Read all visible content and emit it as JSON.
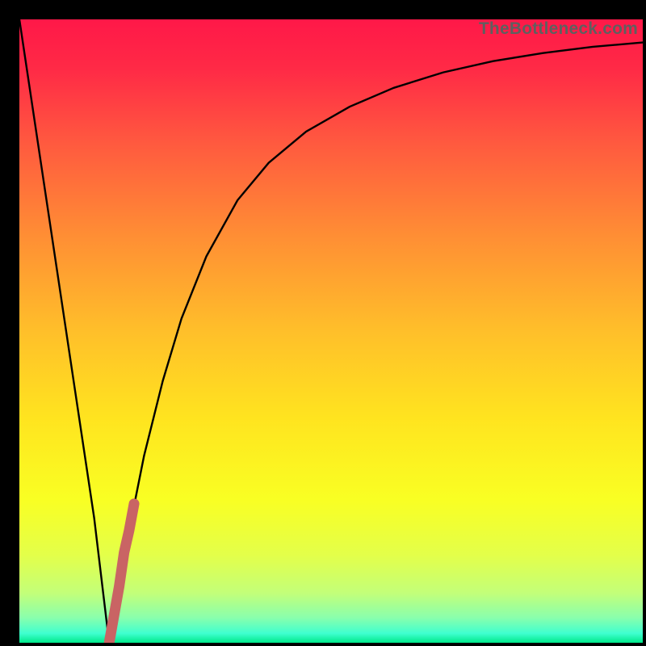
{
  "watermark": {
    "text": "TheBottleneck.com"
  },
  "chart_data": {
    "type": "line",
    "title": "",
    "xlabel": "",
    "ylabel": "",
    "xlim": [
      0,
      100
    ],
    "ylim": [
      0,
      100
    ],
    "grid": false,
    "legend": false,
    "series": [
      {
        "name": "bottleneck-curve",
        "x": [
          0,
          3,
          6,
          9,
          12,
          14.4,
          16,
          18,
          20,
          23,
          26,
          30,
          35,
          40,
          46,
          53,
          60,
          68,
          76,
          84,
          92,
          100
        ],
        "values": [
          100,
          80,
          60,
          40,
          20,
          0,
          9,
          20,
          30,
          42,
          52,
          62,
          71,
          77,
          82,
          86,
          89,
          91.5,
          93.3,
          94.6,
          95.6,
          96.3
        ]
      },
      {
        "name": "highlight-segment",
        "x": [
          14.4,
          15.2,
          16.0,
          16.8,
          17.6,
          18.4
        ],
        "values": [
          0,
          4.5,
          9.0,
          14.5,
          18.0,
          22.3
        ]
      }
    ],
    "background_gradient": {
      "stops": [
        {
          "pos": 0.0,
          "color": "#ff1848"
        },
        {
          "pos": 0.08,
          "color": "#ff2a46"
        },
        {
          "pos": 0.2,
          "color": "#ff5a3f"
        },
        {
          "pos": 0.35,
          "color": "#ff8f34"
        },
        {
          "pos": 0.5,
          "color": "#ffbf2a"
        },
        {
          "pos": 0.64,
          "color": "#ffe41f"
        },
        {
          "pos": 0.77,
          "color": "#f9ff23"
        },
        {
          "pos": 0.86,
          "color": "#e3ff4a"
        },
        {
          "pos": 0.92,
          "color": "#c3ff79"
        },
        {
          "pos": 0.96,
          "color": "#89ffad"
        },
        {
          "pos": 0.985,
          "color": "#3fffcf"
        },
        {
          "pos": 1.0,
          "color": "#00e88a"
        }
      ]
    },
    "colors": {
      "curve": "#000000",
      "highlight": "#c96464"
    }
  }
}
